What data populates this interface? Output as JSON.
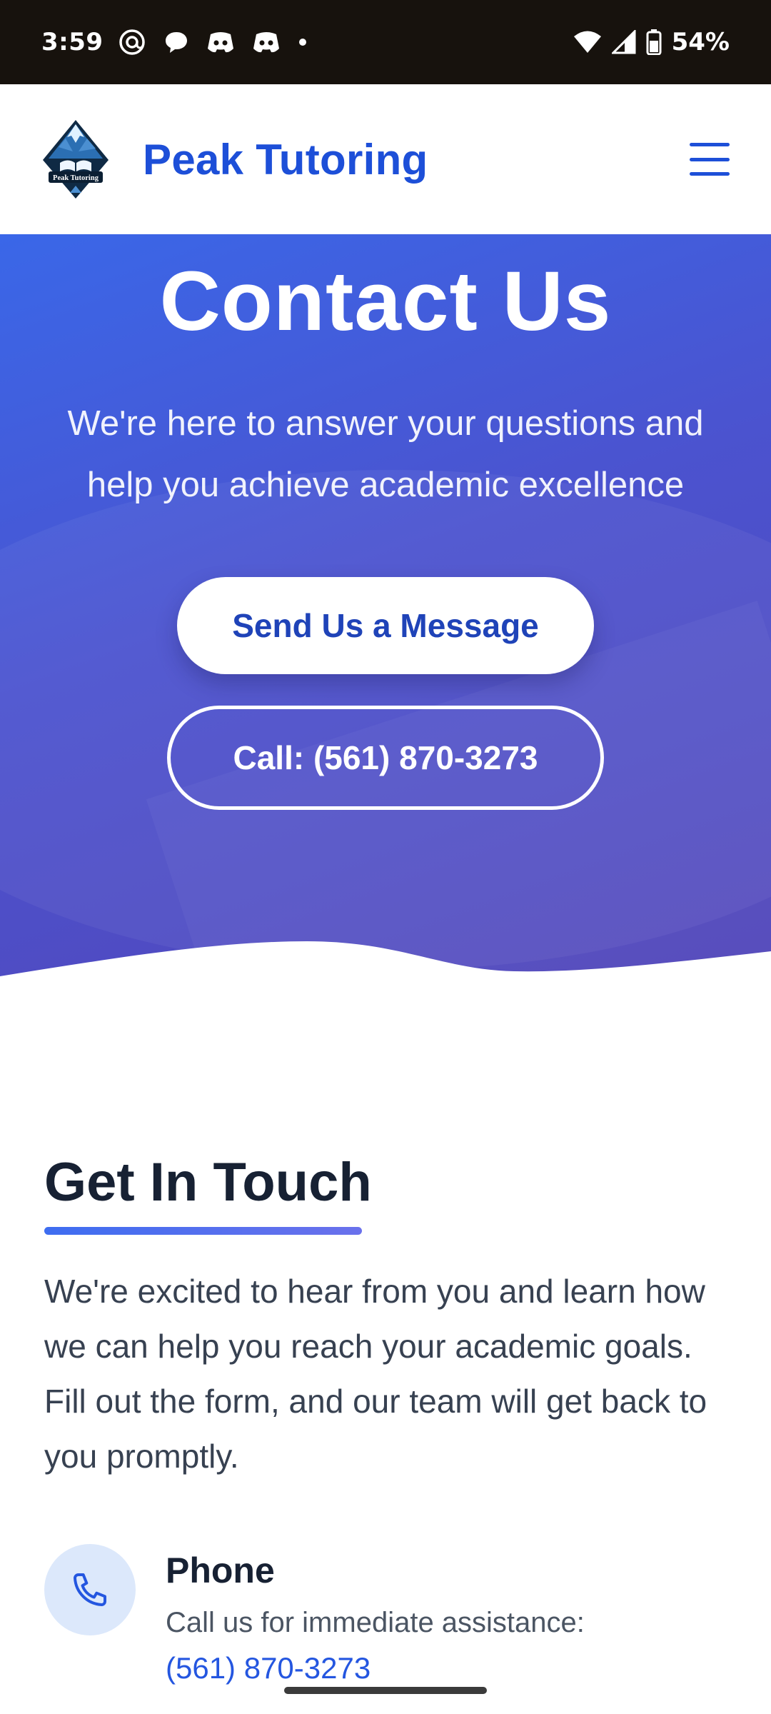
{
  "status_bar": {
    "time": "3:59",
    "battery_percent": "54%",
    "icons": [
      "at-sign-icon",
      "chat-bubble-icon",
      "discord-icon",
      "discord-icon",
      "dot-icon",
      "wifi-icon",
      "signal-icon",
      "battery-icon"
    ]
  },
  "header": {
    "brand_name": "Peak Tutoring",
    "logo_text": "Peak Tutoring",
    "menu_icon": "hamburger-menu-icon",
    "brand_color": "#1d4fd8"
  },
  "hero": {
    "title": "Contact Us",
    "subtitle": "We're here to answer your questions and help you achieve academic excellence",
    "primary_button_label": "Send Us a Message",
    "secondary_button_label": "Call: (561) 870-3273",
    "gradient_start": "#3a67e8",
    "gradient_end": "#5346b9"
  },
  "get_in_touch": {
    "title": "Get In Touch",
    "text": "We're excited to hear from you and learn how we can help you reach your academic goals. Fill out the form, and our team will get back to you promptly."
  },
  "contact_items": [
    {
      "icon": "phone-icon",
      "title": "Phone",
      "description": "Call us for immediate assistance:",
      "link": "(561) 870-3273"
    }
  ]
}
